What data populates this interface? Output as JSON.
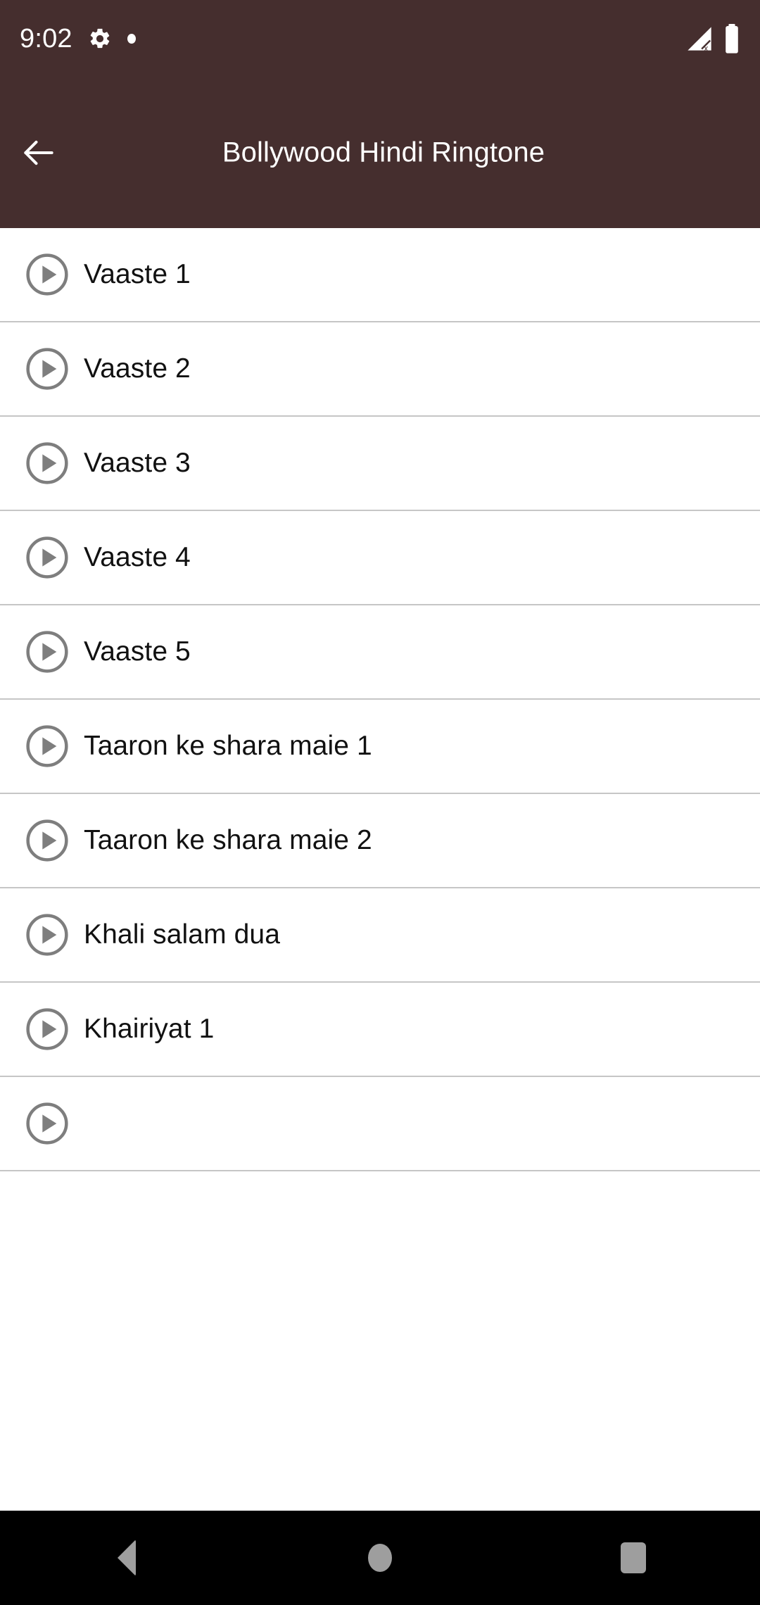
{
  "status_bar": {
    "time": "9:02",
    "icons_left": [
      "gear-icon",
      "dot-icon"
    ],
    "icons_right": [
      "signal-no-sim-icon",
      "battery-icon"
    ],
    "background_color": "#452E2E",
    "foreground_color": "#FFFFFF"
  },
  "app_bar": {
    "title": "Bollywood Hindi Ringtone",
    "back_icon": "arrow-back-icon",
    "background_color": "#452E2E",
    "title_color": "#FFFFFF"
  },
  "list": {
    "item_icon": "play-circle-icon",
    "icon_color": "#7E7E7E",
    "divider_color": "#C6C6C6",
    "text_color": "#111111",
    "items": [
      {
        "label": "Vaaste 1"
      },
      {
        "label": "Vaaste 2"
      },
      {
        "label": "Vaaste 3"
      },
      {
        "label": "Vaaste 4"
      },
      {
        "label": "Vaaste 5"
      },
      {
        "label": "Taaron ke shara maie 1"
      },
      {
        "label": "Taaron ke shara maie 2"
      },
      {
        "label": "Khali salam dua"
      },
      {
        "label": "Khairiyat 1"
      },
      {
        "label": ""
      }
    ]
  },
  "nav_bar": {
    "background_color": "#000000",
    "icon_color": "#9E9E9E",
    "buttons": [
      {
        "name": "back",
        "icon": "nav-back-icon"
      },
      {
        "name": "home",
        "icon": "nav-home-icon"
      },
      {
        "name": "recents",
        "icon": "nav-recents-icon"
      }
    ]
  }
}
